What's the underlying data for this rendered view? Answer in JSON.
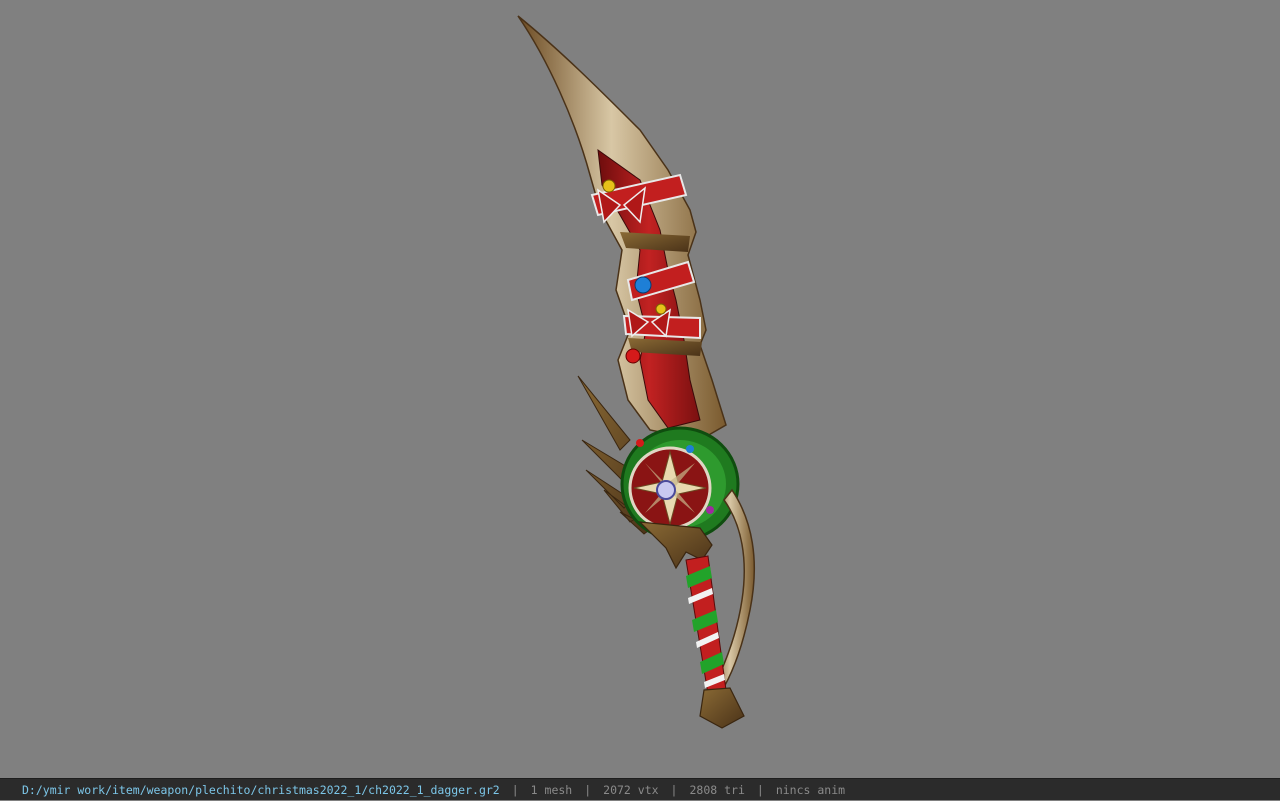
{
  "viewer": {
    "background_color": "#808080",
    "model_subject": "christmas dagger"
  },
  "statusbar": {
    "file_path": "D:/ymir work/item/weapon/plechito/christmas2022_1/ch2022_1_dagger.gr2",
    "separator": "|",
    "mesh_count": "1 mesh",
    "vertex_count": "2072 vtx",
    "triangle_count": "2808 tri",
    "anim_status": "nincs anim",
    "path_color": "#7cc6e8",
    "bar_color": "#2b2b2b"
  }
}
